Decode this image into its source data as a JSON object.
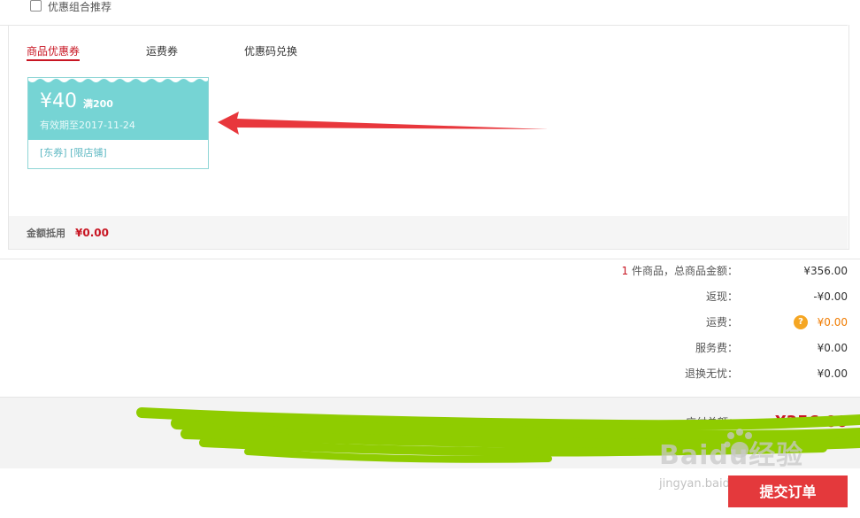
{
  "combo": {
    "label": "优惠组合推荐"
  },
  "tabs": [
    {
      "label": "商品优惠券",
      "active": true
    },
    {
      "label": "运费券",
      "active": false
    },
    {
      "label": "优惠码兑换",
      "active": false
    }
  ],
  "coupon": {
    "amount": "¥40",
    "condition": "满200",
    "validity": "有效期至2017-11-24",
    "tags": "[东券]  [限店铺]"
  },
  "offset": {
    "label": "金额抵用",
    "value": "¥0.00"
  },
  "summary": {
    "count": "1",
    "items_label": " 件商品，总商品金额：",
    "items_value": "¥356.00",
    "cashback_label": "返现：",
    "cashback_value": "-¥0.00",
    "shipping_label": "运费：",
    "shipping_help": "?",
    "shipping_value": "¥0.00",
    "service_label": "服务费：",
    "service_value": "¥0.00",
    "returns_label": "退换无忧：",
    "returns_value": "¥0.00"
  },
  "total": {
    "label": "应付总额：",
    "value": "¥356.00"
  },
  "submit": {
    "label": "提交订单"
  },
  "watermark": {
    "text": "Baidu经验",
    "sub": "jingyan.baidu.com"
  },
  "colors": {
    "accent": "#c81623",
    "coupon": "#76d4d4",
    "submit": "#e4393c",
    "scribble": "#8fcc00",
    "arrow": "#e8373c"
  }
}
